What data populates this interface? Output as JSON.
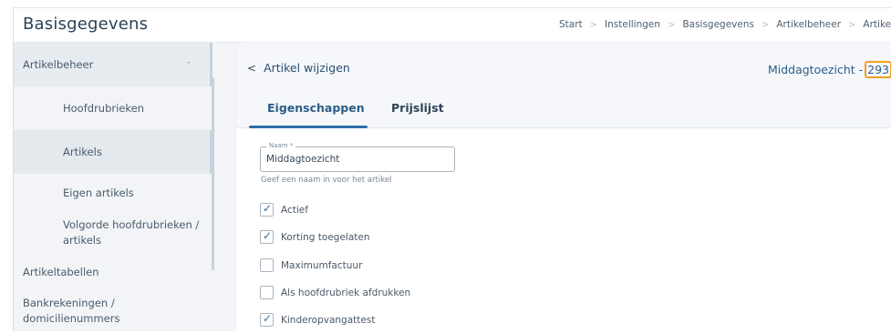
{
  "app": {
    "title": "Basisgegevens"
  },
  "breadcrumb": [
    "Start",
    "Instellingen",
    "Basisgegevens",
    "Artikelbeheer",
    "Artike"
  ],
  "sidebar": {
    "items": [
      {
        "label": "Artikelbeheer",
        "type": "group",
        "expanded": true
      },
      {
        "label": "Hoofdrubrieken",
        "type": "sub"
      },
      {
        "label": "Artikels",
        "type": "sub",
        "active": true
      },
      {
        "label": "Eigen artikels",
        "type": "sub"
      },
      {
        "label_line1": "Volgorde hoofdrubrieken /",
        "label_line2": "artikels",
        "type": "sub"
      },
      {
        "label": "Artikeltabellen",
        "type": "top"
      },
      {
        "label_line1": "Bankrekeningen /",
        "label_line2": "domicilienummers",
        "type": "top"
      }
    ]
  },
  "header": {
    "back_label": "Artikel wijzigen",
    "record_name": "Middagtoezicht -",
    "record_number": "293"
  },
  "tabs": [
    {
      "label": "Eigenschappen",
      "active": true
    },
    {
      "label": "Prijslijst",
      "active": false
    }
  ],
  "form": {
    "name_legend": "Naam *",
    "name_value": "Middagtoezicht",
    "name_help": "Geef een naam in voor het artikel",
    "checkboxes": [
      {
        "label": "Actief",
        "checked": true
      },
      {
        "label": "Korting toegelaten",
        "checked": true
      },
      {
        "label": "Maximumfactuur",
        "checked": false
      },
      {
        "label": "Als hoofdrubriek afdrukken",
        "checked": false
      },
      {
        "label": "Kinderopvangattest",
        "checked": true
      }
    ]
  },
  "colors": {
    "accent": "#2d6ea6",
    "highlight": "#f0a020"
  }
}
